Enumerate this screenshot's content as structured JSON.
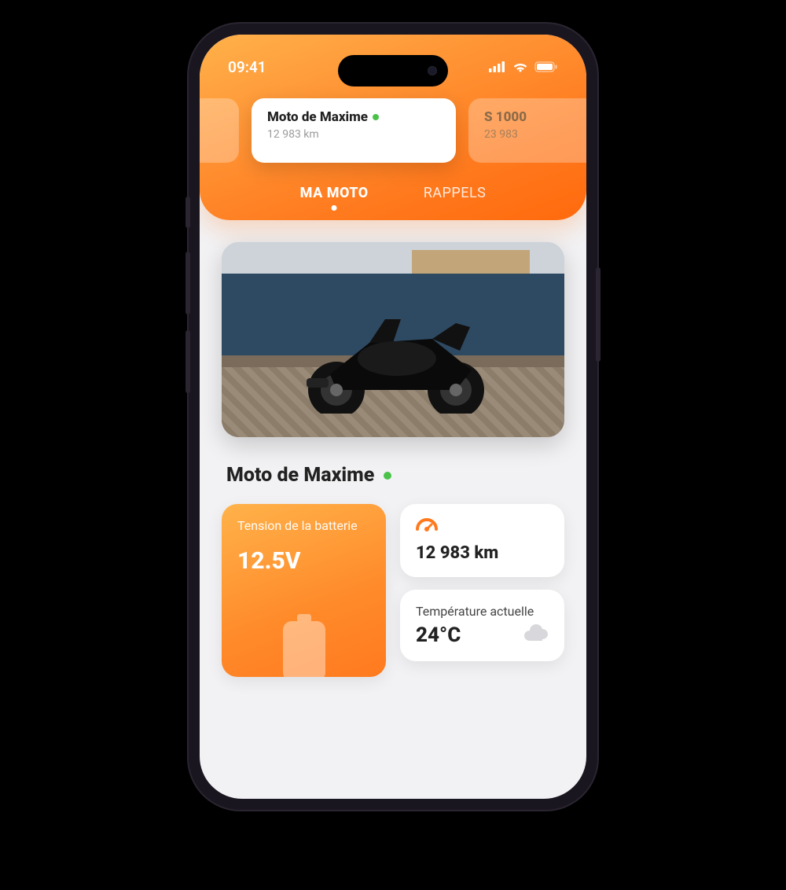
{
  "status_bar": {
    "time": "09:41"
  },
  "vehicle_cards": {
    "active": {
      "name": "Moto de Maxime",
      "odometer": "12 983 km"
    },
    "next": {
      "name": "S 1000",
      "odometer": "23 983"
    }
  },
  "tabs": {
    "my_moto": "MA MOTO",
    "reminders": "RAPPELS"
  },
  "section_title": "Moto de Maxime",
  "widgets": {
    "battery": {
      "label": "Tension de la batterie",
      "value": "12.5V"
    },
    "odometer": {
      "value": "12 983 km"
    },
    "temperature": {
      "label": "Température actuelle",
      "value": "24°C"
    }
  }
}
